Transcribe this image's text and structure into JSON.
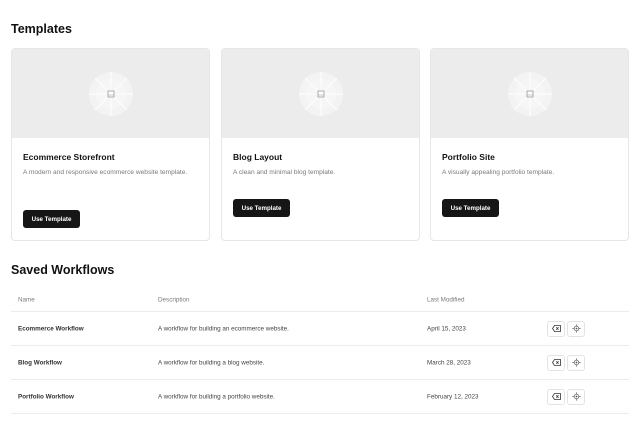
{
  "templates": {
    "title": "Templates",
    "cards": [
      {
        "title": "Ecommerce Storefront",
        "description": "A modern and responsive ecommerce website template.",
        "button_label": "Use Template"
      },
      {
        "title": "Blog Layout",
        "description": "A clean and minimal blog template.",
        "button_label": "Use Template"
      },
      {
        "title": "Portfolio Site",
        "description": "A visually appealing portfolio template.",
        "button_label": "Use Template"
      }
    ]
  },
  "workflows": {
    "title": "Saved Workflows",
    "columns": {
      "name": "Name",
      "description": "Description",
      "last_modified": "Last Modified"
    },
    "rows": [
      {
        "name": "Ecommerce Workflow",
        "description": "A workflow for building an ecommerce website.",
        "last_modified": "April 15, 2023"
      },
      {
        "name": "Blog Workflow",
        "description": "A workflow for building a blog website.",
        "last_modified": "March 28, 2023"
      },
      {
        "name": "Portfolio Workflow",
        "description": "A workflow for building a portfolio website.",
        "last_modified": "February 12, 2023"
      }
    ],
    "row_actions": [
      "delete-icon",
      "settings-icon"
    ]
  },
  "colors": {
    "accent": "#161616",
    "card_image_bg": "#ececec",
    "muted_text": "#7a7a7a"
  },
  "icons": {
    "template_placeholder": "image-placeholder-icon"
  }
}
